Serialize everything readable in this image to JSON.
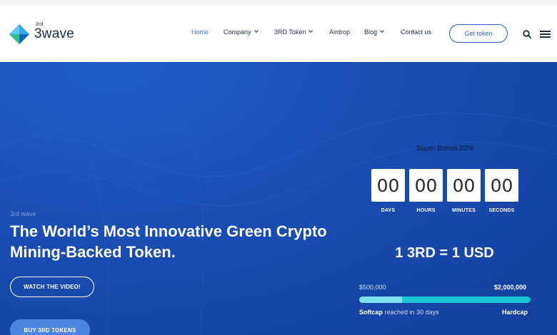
{
  "brand": {
    "name": "3wave",
    "superscript": "3rd"
  },
  "nav": {
    "items": [
      {
        "label": "Home",
        "active": true,
        "dropdown": false
      },
      {
        "label": "Company",
        "active": false,
        "dropdown": true
      },
      {
        "label": "3RD Token",
        "active": false,
        "dropdown": true
      },
      {
        "label": "Airdrop",
        "active": false,
        "dropdown": false
      },
      {
        "label": "Blog",
        "active": false,
        "dropdown": true
      },
      {
        "label": "Contact us",
        "active": false,
        "dropdown": false
      }
    ],
    "cta_label": "Get token",
    "search_icon": "search-icon",
    "menu_icon": "hamburger-menu-icon"
  },
  "hero": {
    "subtitle": "3rd wave",
    "title": "The World’s Most Innovative Green Crypto Mining-Backed Token.",
    "watch_button": "WATCH THE VIDEO!",
    "buy_button": "BUY 3RD TOKENS"
  },
  "countdown": {
    "heading": "Super Bonus 20%",
    "units": [
      {
        "value": "00",
        "label": "DAYS"
      },
      {
        "value": "00",
        "label": "HOURS"
      },
      {
        "value": "00",
        "label": "MINUTES"
      },
      {
        "value": "00",
        "label": "SECONDS"
      }
    ]
  },
  "sale": {
    "rate": "1 3RD = 1 USD",
    "softcap_value": "$500,000",
    "hardcap_value": "$2,000,000",
    "softcap_label": "Softcap",
    "softcap_note": "reached in 30 days",
    "hardcap_label": "Hardcap",
    "progress_fraction": 0.25
  },
  "colors": {
    "accent": "#3a74d6",
    "hero_bg": "#1a4fb6",
    "progress_track": "#18c6d3",
    "progress_fill": "#7fe0f0",
    "buy_button": "#4a86e0"
  }
}
